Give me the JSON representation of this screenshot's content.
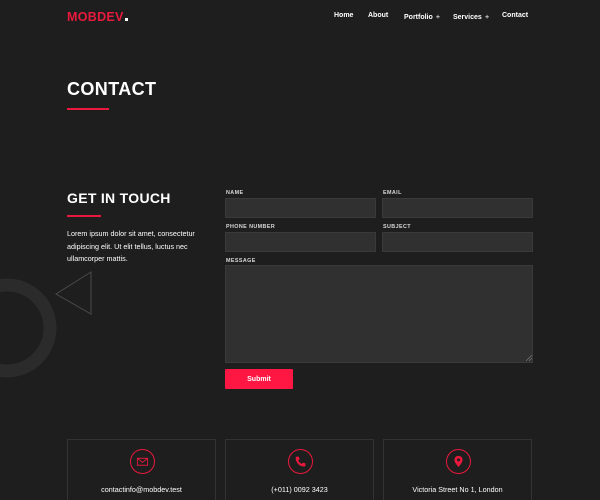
{
  "brand": {
    "logo_text": "MOBDEV",
    "accent_color": "#e8193c",
    "button_color": "#ff1744"
  },
  "nav": {
    "items": [
      {
        "label": "Home"
      },
      {
        "label": "About"
      },
      {
        "label": "Portfolio",
        "expand": "+"
      },
      {
        "label": "Services",
        "expand": "+"
      },
      {
        "label": "Contact"
      }
    ]
  },
  "page": {
    "title": "CONTACT"
  },
  "get_in_touch": {
    "heading": "GET IN TOUCH",
    "text": "Lorem ipsum dolor sit amet, consectetur adipiscing elit. Ut elit tellus, luctus nec ullamcorper mattis."
  },
  "form": {
    "name_label": "NAME",
    "name_value": "",
    "email_label": "EMAIL",
    "email_value": "",
    "phone_label": "PHONE NUMBER",
    "phone_value": "",
    "subject_label": "SUBJECT",
    "subject_value": "",
    "message_label": "MESSAGE",
    "message_value": "",
    "submit_label": "Submit"
  },
  "info_cards": [
    {
      "icon": "mail-icon",
      "text": "contactinfo@mobdev.test"
    },
    {
      "icon": "phone-icon",
      "text": "(+011) 0092 3423"
    },
    {
      "icon": "location-pin-icon",
      "text": "Victoria Street No 1, London"
    }
  ]
}
